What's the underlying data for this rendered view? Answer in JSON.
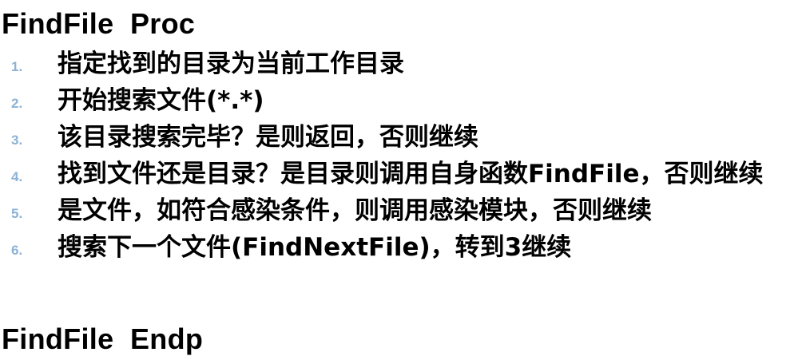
{
  "heading_start": "FindFile  Proc",
  "heading_end": "FindFile  Endp",
  "steps": [
    {
      "num": "1.",
      "text": "指定找到的目录为当前工作目录"
    },
    {
      "num": "2.",
      "text": "开始搜索文件(*.*)"
    },
    {
      "num": "3.",
      "text": "该目录搜索完毕？是则返回，否则继续"
    },
    {
      "num": "4.",
      "text": "找到文件还是目录？是目录则调用自身函数FindFile，否则继续"
    },
    {
      "num": "5.",
      "text": "是文件，如符合感染条件，则调用感染模块，否则继续"
    },
    {
      "num": "6.",
      "text": "搜索下一个文件(FindNextFile)，转到3继续"
    }
  ],
  "colors": {
    "text": "#000000",
    "step_number": "#8cb2d6",
    "background": "#ffffff"
  }
}
